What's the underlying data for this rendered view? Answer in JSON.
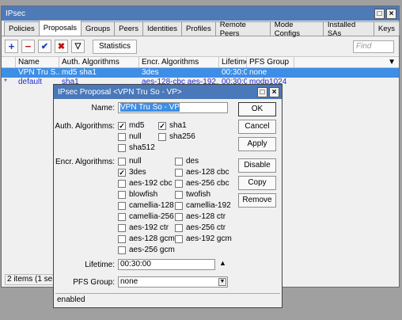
{
  "main": {
    "title": "IPsec",
    "tabs": [
      "Policies",
      "Proposals",
      "Groups",
      "Peers",
      "Identities",
      "Profiles",
      "Remote Peers",
      "Mode Configs",
      "Installed SAs",
      "Keys"
    ],
    "active_tab": "Proposals",
    "statistics_label": "Statistics",
    "find_placeholder": "Find",
    "columns": [
      "Name",
      "Auth. Algorithms",
      "Encr. Algorithms",
      "Lifetime",
      "PFS Group"
    ],
    "rows": [
      {
        "flag": "",
        "name": "VPN Tru S...",
        "auth": "md5 sha1",
        "encr": "3des",
        "lifetime": "00:30:00",
        "pfs": "none"
      },
      {
        "flag": "*",
        "name": "default",
        "auth": "sha1",
        "encr": "aes-128-cbc aes-192...",
        "lifetime": "00:30:00",
        "pfs": "modp1024"
      }
    ],
    "status": "2 items (1 selected)"
  },
  "dialog": {
    "title": "IPsec Proposal <VPN Tru So - VP>",
    "name_label": "Name:",
    "name_value": "VPN Tru So - VP",
    "auth_label": "Auth. Algorithms:",
    "auth": [
      {
        "label": "md5",
        "checked": true
      },
      {
        "label": "sha1",
        "checked": true
      },
      {
        "label": "null",
        "checked": false
      },
      {
        "label": "sha256",
        "checked": false
      },
      {
        "label": "sha512",
        "checked": false
      }
    ],
    "encr_label": "Encr. Algorithms:",
    "encr": [
      {
        "label": "null",
        "checked": false
      },
      {
        "label": "des",
        "checked": false
      },
      {
        "label": "3des",
        "checked": true
      },
      {
        "label": "aes-128 cbc",
        "checked": false
      },
      {
        "label": "aes-192 cbc",
        "checked": false
      },
      {
        "label": "aes-256 cbc",
        "checked": false
      },
      {
        "label": "blowfish",
        "checked": false
      },
      {
        "label": "twofish",
        "checked": false
      },
      {
        "label": "camellia-128",
        "checked": false
      },
      {
        "label": "camellia-192",
        "checked": false
      },
      {
        "label": "camellia-256",
        "checked": false
      },
      {
        "label": "aes-128 ctr",
        "checked": false
      },
      {
        "label": "aes-192 ctr",
        "checked": false
      },
      {
        "label": "aes-256 ctr",
        "checked": false
      },
      {
        "label": "aes-128 gcm",
        "checked": false
      },
      {
        "label": "aes-192 gcm",
        "checked": false
      },
      {
        "label": "aes-256 gcm",
        "checked": false
      }
    ],
    "lifetime_label": "Lifetime:",
    "lifetime_value": "00:30:00",
    "pfs_label": "PFS Group:",
    "pfs_value": "none",
    "buttons": {
      "ok": "OK",
      "cancel": "Cancel",
      "apply": "Apply",
      "disable": "Disable",
      "copy": "Copy",
      "remove": "Remove"
    },
    "status": "enabled"
  }
}
